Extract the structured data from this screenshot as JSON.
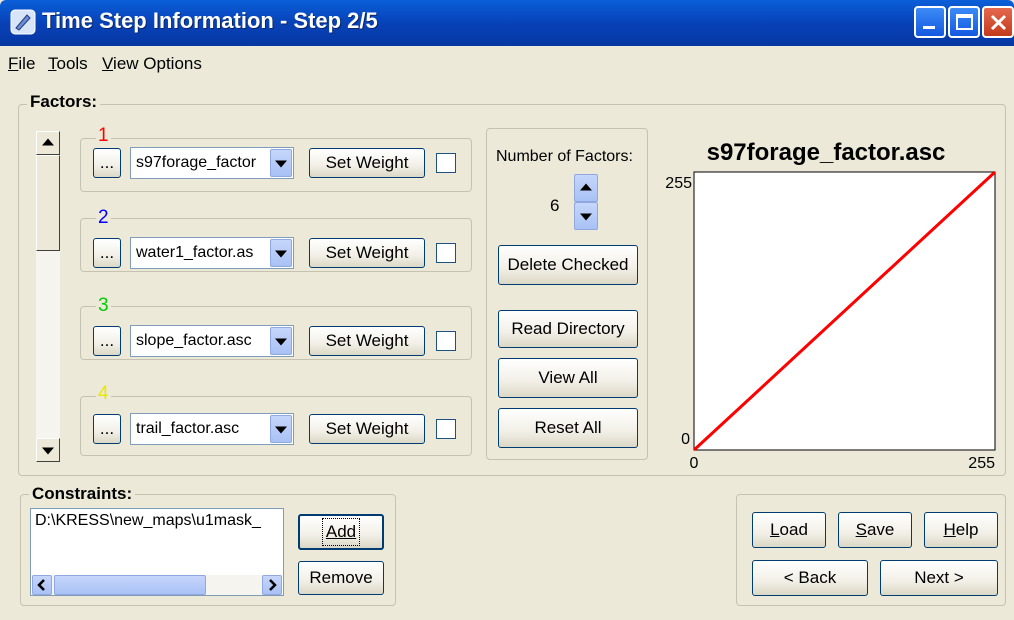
{
  "window": {
    "title": "Time Step Information - Step 2/5"
  },
  "menu": [
    {
      "label": "File",
      "u": "F",
      "rest": "ile"
    },
    {
      "label": "Tools",
      "u": "T",
      "rest": "ools"
    },
    {
      "label": "View Options",
      "u": "V",
      "rest": "iew Options"
    }
  ],
  "factors": {
    "label": "Factors:",
    "browse_label": "...",
    "set_weight_label": "Set Weight",
    "items": [
      {
        "number": "1",
        "color": "#ff0000",
        "file": "s97forage_factor",
        "checked": false
      },
      {
        "number": "2",
        "color": "#0000ff",
        "file": "water1_factor.as",
        "checked": false
      },
      {
        "number": "3",
        "color": "#00cc00",
        "file": "slope_factor.asc",
        "checked": false
      },
      {
        "number": "4",
        "color": "#e8e800",
        "file": "trail_factor.asc",
        "checked": false
      }
    ],
    "number_of_factors_label": "Number of Factors:",
    "number_of_factors": "6",
    "delete_checked_label": "Delete Checked",
    "read_directory_label": "Read Directory",
    "view_all_label": "View All",
    "reset_all_label": "Reset All"
  },
  "chart_data": {
    "type": "line",
    "title": "s97forage_factor.asc",
    "xlabel": "",
    "ylabel": "",
    "x_ticks": [
      "0",
      "255"
    ],
    "y_ticks": [
      "0",
      "255"
    ],
    "xlim": [
      0,
      255
    ],
    "ylim": [
      0,
      255
    ],
    "line_color": "#ff0000",
    "grid": false,
    "series": [
      {
        "x": [
          0,
          255
        ],
        "y": [
          0,
          255
        ]
      }
    ]
  },
  "constraints": {
    "label": "Constraints:",
    "items": [
      "D:\\KRESS\\new_maps\\u1mask_"
    ],
    "add_label": "Add",
    "remove_label": "Remove"
  },
  "nav": {
    "load": {
      "u": "L",
      "rest": "oad"
    },
    "save": {
      "u": "S",
      "rest": "ave"
    },
    "help": {
      "u": "H",
      "rest": "elp"
    },
    "back_label": "< Back",
    "next_label": "Next >"
  }
}
